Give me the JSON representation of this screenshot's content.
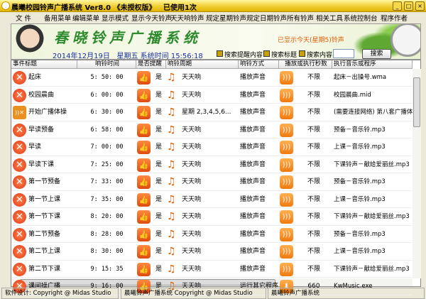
{
  "window": {
    "title": "晨曦校园铃声广播系统 Ver8.0 《未授权版》   已使用1次"
  },
  "menu": [
    "文 件",
    "备用菜单",
    "编辑菜单",
    "显示模式",
    "显示今天铃声",
    "天天响铃声",
    "规定星期铃声",
    "规定日期铃声",
    "所有铃声",
    "相关工具",
    "系统控制台",
    "程序作者"
  ],
  "banner": {
    "title": "春晓铃声广播系统",
    "notice": "已显示今天(星期5)铃声",
    "date": "2014年12月19日",
    "weekday": "星期五",
    "time_label": "系统时间",
    "time": "15:56:18"
  },
  "search": {
    "options": [
      "搜索提醒内容",
      "搜索标题",
      "搜索内容"
    ],
    "input_value": "",
    "button": "搜索"
  },
  "table": {
    "columns": [
      "事件标题",
      "响铃时间",
      "是否提醒",
      "响铃周期",
      "响铃方式",
      "播放或执行秒数",
      "执行音乐或程序"
    ],
    "rows": [
      {
        "title": "起床",
        "time": "5: 50: 00",
        "remind": "是",
        "cycle": "天天响",
        "method": "播放声音",
        "seconds": "不限",
        "program": "起床－出操号.wma",
        "icon": "close-icon",
        "method_icon": "rss-icon"
      },
      {
        "title": "校园晨曲",
        "time": "6: 00: 00",
        "remind": "是",
        "cycle": "天天响",
        "method": "播放声音",
        "seconds": "不限",
        "program": "校园晨曲.mid",
        "icon": "close-icon",
        "method_icon": "rss-icon"
      },
      {
        "title": "开始广播体操",
        "time": "6: 30: 00",
        "remind": "是",
        "cycle": "星期 2,3,4,5,6...",
        "method": "播放声音",
        "seconds": "不限",
        "program": "(需要连接网络) 第八套广播体",
        "icon": "rss-disabled-icon",
        "method_icon": "rss-icon"
      },
      {
        "title": "早读预备",
        "time": "6: 58: 00",
        "remind": "是",
        "cycle": "天天响",
        "method": "播放声音",
        "seconds": "不限",
        "program": "预备－音乐铃.mp3",
        "icon": "close-icon",
        "method_icon": "rss-icon"
      },
      {
        "title": "早读",
        "time": "7: 00: 00",
        "remind": "是",
        "cycle": "天天响",
        "method": "播放声音",
        "seconds": "不限",
        "program": "上课－音乐铃.mp3",
        "icon": "close-icon",
        "method_icon": "rss-icon"
      },
      {
        "title": "早读下课",
        "time": "7: 25: 00",
        "remind": "是",
        "cycle": "天天响",
        "method": "播放声音",
        "seconds": "不限",
        "program": "下课铃声－献给爱丽丝.mp3",
        "icon": "close-icon",
        "method_icon": "rss-icon"
      },
      {
        "title": "第一节预备",
        "time": "7: 33: 00",
        "remind": "是",
        "cycle": "天天响",
        "method": "播放声音",
        "seconds": "不限",
        "program": "预备－音乐铃.mp3",
        "icon": "close-icon",
        "method_icon": "rss-icon"
      },
      {
        "title": "第一节上课",
        "time": "7: 35: 00",
        "remind": "是",
        "cycle": "天天响",
        "method": "播放声音",
        "seconds": "不限",
        "program": "上课－音乐铃.mp3",
        "icon": "close-icon",
        "method_icon": "rss-icon"
      },
      {
        "title": "第一节下课",
        "time": "8: 20: 00",
        "remind": "是",
        "cycle": "天天响",
        "method": "播放声音",
        "seconds": "不限",
        "program": "下课铃声－献给爱丽丝.mp3",
        "icon": "close-icon",
        "method_icon": "rss-icon"
      },
      {
        "title": "第二节预备",
        "time": "8: 28: 00",
        "remind": "是",
        "cycle": "天天响",
        "method": "播放声音",
        "seconds": "不限",
        "program": "预备－音乐铃.mp3",
        "icon": "close-icon",
        "method_icon": "rss-icon"
      },
      {
        "title": "第二节上课",
        "time": "8: 30: 00",
        "remind": "是",
        "cycle": "天天响",
        "method": "播放声音",
        "seconds": "不限",
        "program": "上课－音乐铃.mp3",
        "icon": "close-icon",
        "method_icon": "rss-icon"
      },
      {
        "title": "第二节下课",
        "time": "9: 15: 35",
        "remind": "是",
        "cycle": "天天响",
        "method": "播放声音",
        "seconds": "不限",
        "program": "下课铃声－献给爱丽丝.mp3",
        "icon": "close-icon",
        "method_icon": "rss-icon"
      },
      {
        "title": "课间操广播",
        "time": "9: 16: 00",
        "remind": "是",
        "cycle": "天天响",
        "method": "运行其它程序",
        "seconds": "660",
        "program": "KwMusic.exe",
        "icon": "close-icon",
        "method_icon": "download-icon"
      }
    ]
  },
  "status": [
    "软件设计: Copyright @ Midas Studio",
    "晨曦铃声广播系统 Copyright @ Midas Studio",
    "晨曦铃声广播系统"
  ]
}
